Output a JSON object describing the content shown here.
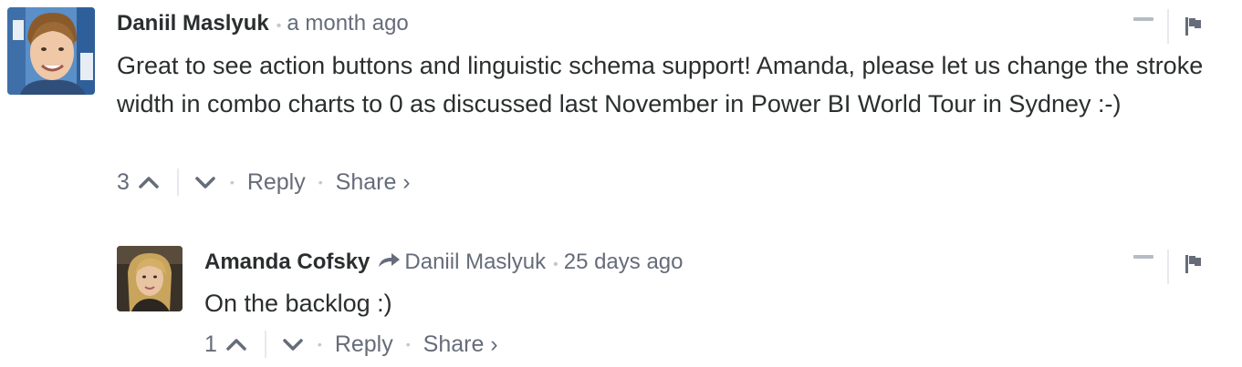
{
  "comments": [
    {
      "author": "Daniil Maslyuk",
      "separator": "•",
      "time": "a month ago",
      "text": "Great to see action buttons and linguistic schema support! Amanda, please let us change the stroke width in combo charts to 0 as discussed last November in Power BI World Tour in Sydney :-)",
      "votes": "3",
      "reply_label": "Reply",
      "share_label": "Share ›",
      "footer_dot": "•"
    },
    {
      "author": "Amanda Cofsky",
      "in_reply_to": "Daniil Maslyuk",
      "separator": "•",
      "time": "25 days ago",
      "text": "On the backlog :)",
      "votes": "1",
      "reply_label": "Reply",
      "share_label": "Share ›",
      "footer_dot": "•"
    }
  ],
  "icons": {
    "upvote": "chevron-up-icon",
    "downvote": "chevron-down-icon",
    "collapse": "minus-icon",
    "flag": "flag-icon",
    "reply_to": "reply-arrow-icon"
  },
  "colors": {
    "text": "#2a2e2e",
    "muted": "#656c7a",
    "divider": "#e7e9ee",
    "dot": "#c3c9cd"
  }
}
